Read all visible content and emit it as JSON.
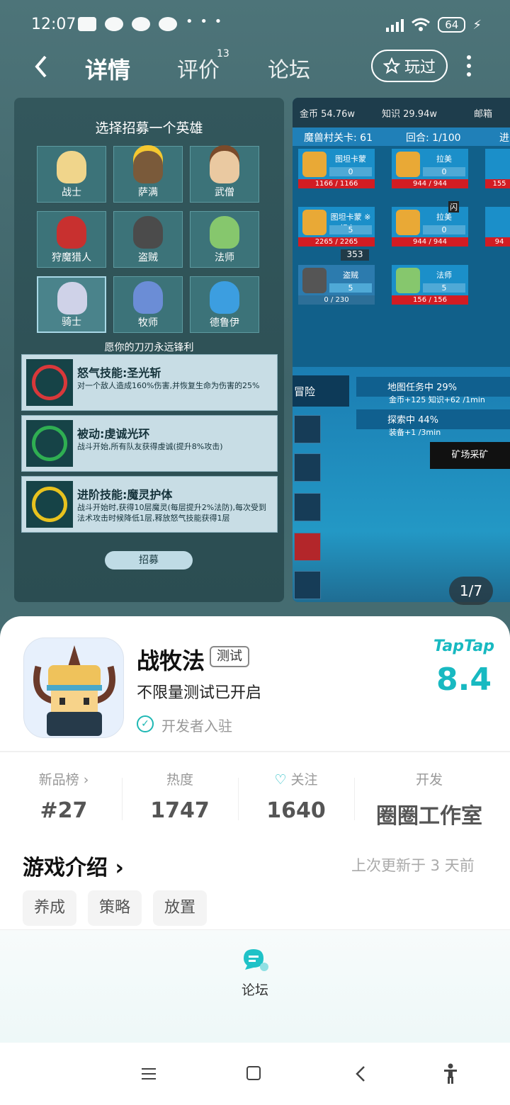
{
  "status": {
    "time": "12:07",
    "dots": "• • •",
    "battery": "64",
    "bolt": "⚡"
  },
  "header": {
    "tabs": [
      "详情",
      "评价",
      "论坛"
    ],
    "review_count": "13",
    "played_label": "玩过"
  },
  "screenshot1": {
    "title": "选择招募一个英雄",
    "heroes": [
      "战士",
      "萨满",
      "武僧",
      "狩魔猎人",
      "盗贼",
      "法师",
      "骑士",
      "牧师",
      "德鲁伊"
    ],
    "motto": "愿你的刀刃永远锋利",
    "skills": [
      {
        "name": "怒气技能:圣光斩",
        "desc": "对一个敌人造成160%伤害,并恢复生命为伤害的25%"
      },
      {
        "name": "被动:虔诚光环",
        "desc": "战斗开始,所有队友获得虔诚(提升8%攻击)"
      },
      {
        "name": "进阶技能:魔灵护体",
        "desc": "战斗开始时,获得10层魔灵(每层提升2%法防),每次受到法术攻击时候降低1层,释放怒气技能获得1层"
      }
    ],
    "recruit_label": "招募"
  },
  "screenshot2": {
    "gold": "金币 54.76w",
    "knowledge": "知识 29.94w",
    "mail": "邮箱",
    "stage": "魔兽村关卡: 61",
    "round": "回合: 1/100",
    "round_trail": "进",
    "units": [
      {
        "name": "图坦卡蒙",
        "level": "0",
        "hp": "1166 / 1166"
      },
      {
        "name": "拉美",
        "level": "0",
        "hp": "944 / 944"
      },
      {
        "name": "图坦卡蒙 ※领主※",
        "level": "5",
        "hp": "2265 / 2265"
      },
      {
        "name": "拉美",
        "level": "0",
        "hp": "944 / 944"
      },
      {
        "name": "盗贼",
        "level": "5",
        "hp": "0 / 230"
      },
      {
        "name": "法师",
        "level": "5",
        "hp": "156 / 156"
      }
    ],
    "level_badge": "353",
    "flash_label": "闪",
    "side_hp_a": "155",
    "side_hp_b": "94",
    "adventure": "冒险",
    "task1_title": "地图任务中 29%",
    "task1_detail": "金币+125  知识+62  /1min",
    "task2_title": "探索中 44%",
    "task2_detail": "装备+1 /3min",
    "mine": "矿场采矿"
  },
  "counter": "1/7",
  "app": {
    "name": "战牧法",
    "tag": "测试",
    "subtitle": "不限量测试已开启",
    "dev_text": "开发者入驻",
    "brand": "TapTap",
    "score": "8.4"
  },
  "stats": [
    {
      "label": "新品榜 ›",
      "value": "#27"
    },
    {
      "label": "热度",
      "value": "1747"
    },
    {
      "label": "关注",
      "value": "1640"
    },
    {
      "label": "开发",
      "value": "圈圈工作室"
    }
  ],
  "intro": {
    "title": "游戏介绍",
    "updated": "上次更新于 3 天前",
    "tags": [
      "养成",
      "策略",
      "放置"
    ]
  },
  "bottom": {
    "forum_label": "论坛"
  },
  "colors": {
    "accent": "#18b9c1",
    "hero_bg": "#466d72"
  }
}
